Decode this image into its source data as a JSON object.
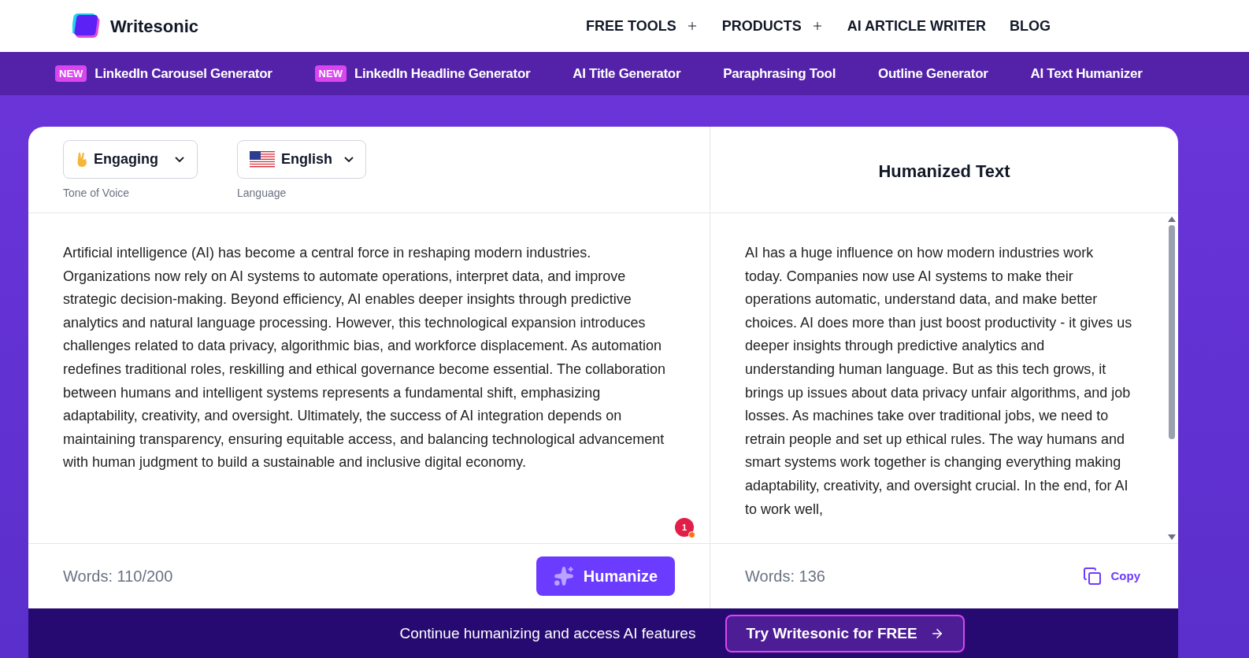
{
  "header": {
    "brand": "Writesonic",
    "nav": [
      {
        "label": "FREE TOOLS",
        "kind": "dropdown"
      },
      {
        "label": "PRODUCTS",
        "kind": "dropdown"
      },
      {
        "label": "AI ARTICLE WRITER",
        "kind": "link"
      },
      {
        "label": "BLOG",
        "kind": "link"
      }
    ]
  },
  "promo_bar": [
    {
      "label": "LinkedIn Carousel Generator",
      "badge": "NEW"
    },
    {
      "label": "LinkedIn Headline Generator",
      "badge": "NEW"
    },
    {
      "label": "AI Title Generator"
    },
    {
      "label": "Paraphrasing Tool"
    },
    {
      "label": "Outline Generator"
    },
    {
      "label": "AI Text Humanizer"
    }
  ],
  "input_panel": {
    "tone": {
      "value": "Engaging",
      "caption": "Tone of Voice"
    },
    "language": {
      "value": "English",
      "caption": "Language"
    },
    "text": "Artificial intelligence (AI) has become a central force in reshaping modern industries. Organizations now rely on AI systems to automate operations, interpret data, and improve strategic decision-making. Beyond efficiency, AI enables deeper insights through predictive analytics and natural language processing. However, this technological expansion introduces challenges related to data privacy, algorithmic bias, and workforce displacement. As automation redefines traditional roles, reskilling and ethical governance become essential. The collaboration between humans and intelligent systems represents a fundamental shift, emphasizing adaptability, creativity, and oversight. Ultimately, the success of AI integration depends on maintaining transparency, ensuring equitable access, and balancing technological advancement with human judgment to build a sustainable and inclusive digital economy.",
    "issue_count": "1",
    "word_count": "Words: 110/200",
    "button": "Humanize"
  },
  "output_panel": {
    "title": "Humanized Text",
    "text": "AI has a huge influence on how modern industries work today. Companies now use AI systems to make their operations automatic, understand data, and make better choices. AI does more than just boost productivity - it gives us deeper insights through predictive analytics and understanding human language. But as this tech grows, it brings up issues about data privacy unfair algorithms, and job losses. As machines take over traditional jobs, we need to retrain people and set up ethical rules. The way humans and smart systems work together is changing everything making adaptability, creativity, and oversight crucial. In the end, for AI to work well,",
    "word_count": "Words: 136",
    "copy": "Copy"
  },
  "cta_bar": {
    "text": "Continue humanizing and access AI features",
    "button": "Try Writesonic for FREE"
  }
}
